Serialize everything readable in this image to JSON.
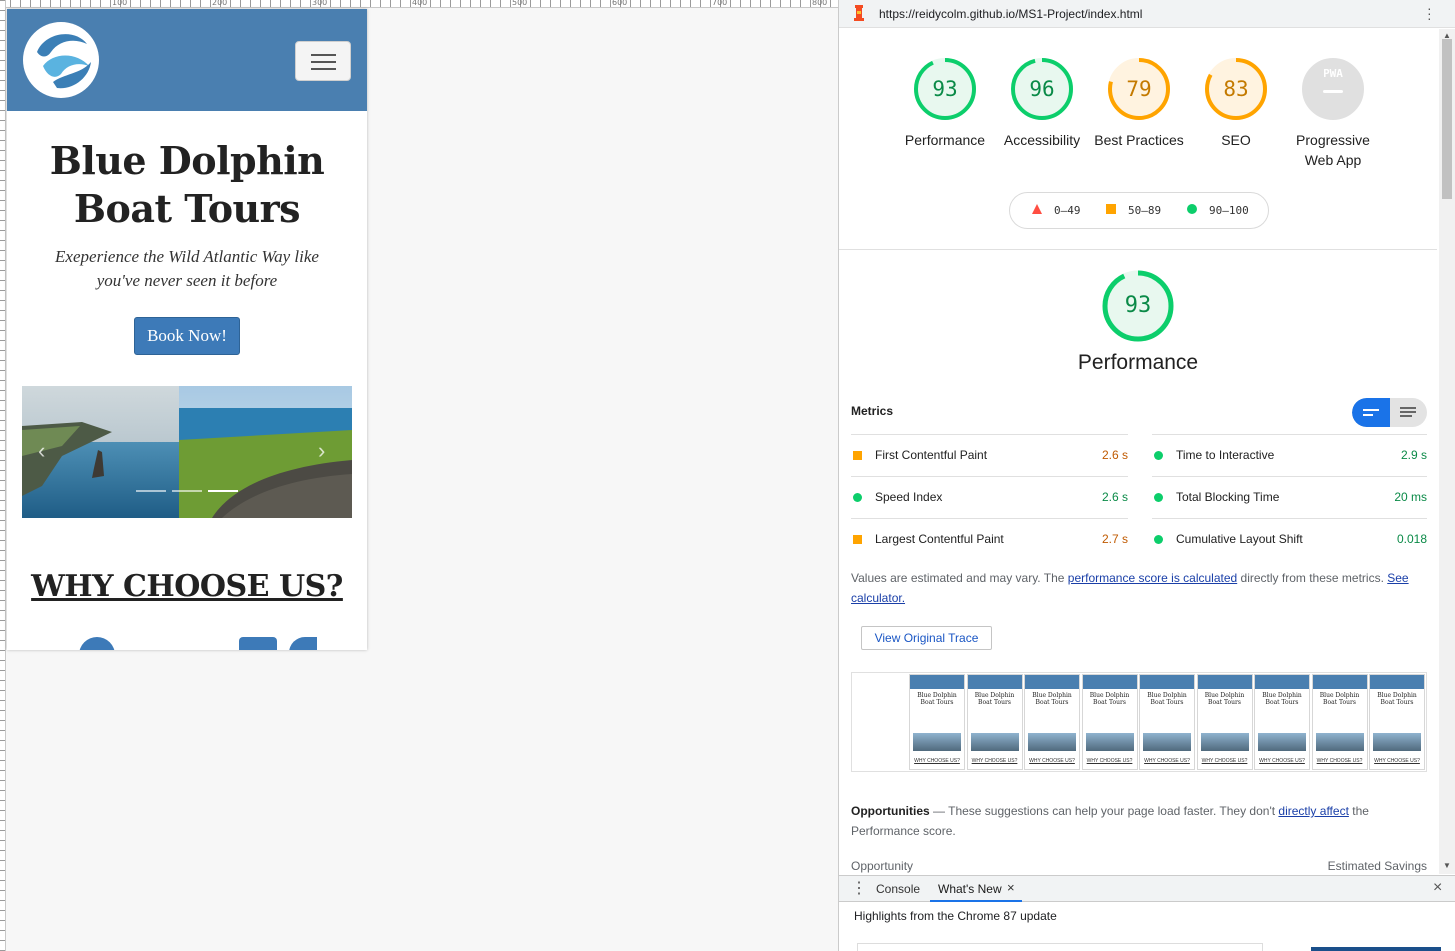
{
  "browser": {
    "url": "https://reidycolm.github.io/MS1-Project/index.html"
  },
  "rulers": {
    "labels": [
      "100",
      "200",
      "300",
      "400",
      "500",
      "600",
      "700",
      "800"
    ]
  },
  "site": {
    "title": "Blue Dolphin Boat Tours",
    "subtitle": "Exeperience the Wild Atlantic Way like you've never seen it before",
    "book_button": "Book Now!",
    "why_heading": "WHY CHOOSE US?",
    "carousel": {
      "prev": "‹",
      "next": "›"
    }
  },
  "report": {
    "gauges": [
      {
        "score": "93",
        "label": "Performance",
        "color": "#0cce6b",
        "value": 93
      },
      {
        "score": "96",
        "label": "Accessibility",
        "color": "#0cce6b",
        "value": 96
      },
      {
        "score": "79",
        "label": "Best Practices",
        "color": "#ffa400",
        "value": 79
      },
      {
        "score": "83",
        "label": "SEO",
        "color": "#ffa400",
        "value": 83
      },
      {
        "score": "PWA",
        "label": "Progressive Web App",
        "color": "#9e9e9e",
        "value": 0
      }
    ],
    "legend": [
      {
        "range": "0–49",
        "color": "#ff4e42",
        "shape": "triangle"
      },
      {
        "range": "50–89",
        "color": "#ffa400",
        "shape": "square"
      },
      {
        "range": "90–100",
        "color": "#0cce6b",
        "shape": "circle"
      }
    ],
    "main_gauge": {
      "score": "93",
      "label": "Performance",
      "color": "#0cce6b",
      "value": 93
    },
    "metrics_title": "Metrics",
    "metrics": [
      {
        "name": "First Contentful Paint",
        "value": "2.6 s",
        "status": "average"
      },
      {
        "name": "Time to Interactive",
        "value": "2.9 s",
        "status": "pass"
      },
      {
        "name": "Speed Index",
        "value": "2.6 s",
        "status": "pass"
      },
      {
        "name": "Total Blocking Time",
        "value": "20 ms",
        "status": "pass"
      },
      {
        "name": "Largest Contentful Paint",
        "value": "2.7 s",
        "status": "average"
      },
      {
        "name": "Cumulative Layout Shift",
        "value": "0.018",
        "status": "pass"
      }
    ],
    "note": {
      "prefix": "Values are estimated and may vary. The ",
      "link1": "performance score is calculated",
      "middle": " directly from these metrics. ",
      "link2": "See calculator."
    },
    "trace_button": "View Original Trace",
    "filmstrip": {
      "frame_title": "Blue Dolphin Boat Tours",
      "frame_why": "WHY CHOOSE US?",
      "frames": 9
    },
    "opportunities": {
      "title": "Opportunities",
      "dash": " — ",
      "text1": "These suggestions can help your page load faster. They don't ",
      "link": "directly affect",
      "text2": " the Performance score."
    },
    "opp_header": {
      "left": "Opportunity",
      "right": "Estimated Savings"
    }
  },
  "drawer": {
    "tabs": [
      "Console",
      "What's New"
    ],
    "active_tab": "What's New",
    "close_tab": "×",
    "close_drawer": "×",
    "body": "Highlights from the Chrome 87 update"
  },
  "colors": {
    "pass": "#0cce6b",
    "average": "#ffa400",
    "fail": "#ff4e42",
    "nav_blue": "#4a7fb0",
    "button_blue": "#3d7ab8"
  }
}
